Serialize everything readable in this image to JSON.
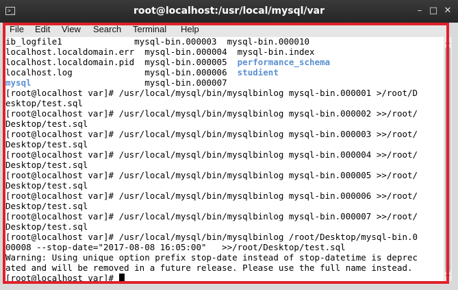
{
  "window": {
    "title": "root@localhost:/usr/local/mysql/var",
    "minimize": "–",
    "maximize": "□",
    "close": "✕",
    "icon_glyph": ">_"
  },
  "menu": [
    "File",
    "Edit",
    "View",
    "Search",
    "Terminal",
    "Help"
  ],
  "terminal": {
    "lines": [
      [
        {
          "t": "ib_logfile1              mysql-bin.000003  mysql-bin.000010"
        }
      ],
      [
        {
          "t": "localhost.localdomain.err  mysql-bin.000004  mysql-bin.index"
        }
      ],
      [
        {
          "t": "localhost.localdomain.pid  mysql-bin.000005  "
        },
        {
          "t": "performance_schema",
          "c": "blue"
        }
      ],
      [
        {
          "t": "localhost.log              mysql-bin.000006  "
        },
        {
          "t": "studient",
          "c": "blue"
        }
      ],
      [
        {
          "t": "mysql",
          "c": "blue"
        },
        {
          "t": "                      mysql-bin.000007"
        }
      ],
      [
        {
          "t": "[root@localhost var]# /usr/local/mysql/bin/mysqlbinlog mysql-bin.000001 >/root/D"
        }
      ],
      [
        {
          "t": "esktop/test.sql"
        }
      ],
      [
        {
          "t": "[root@localhost var]# /usr/local/mysql/bin/mysqlbinlog mysql-bin.000002 >>/root/"
        }
      ],
      [
        {
          "t": "Desktop/test.sql"
        }
      ],
      [
        {
          "t": "[root@localhost var]# /usr/local/mysql/bin/mysqlbinlog mysql-bin.000003 >>/root/"
        }
      ],
      [
        {
          "t": "Desktop/test.sql"
        }
      ],
      [
        {
          "t": "[root@localhost var]# /usr/local/mysql/bin/mysqlbinlog mysql-bin.000004 >>/root/"
        }
      ],
      [
        {
          "t": "Desktop/test.sql"
        }
      ],
      [
        {
          "t": "[root@localhost var]# /usr/local/mysql/bin/mysqlbinlog mysql-bin.000005 >>/root/"
        }
      ],
      [
        {
          "t": "Desktop/test.sql"
        }
      ],
      [
        {
          "t": "[root@localhost var]# /usr/local/mysql/bin/mysqlbinlog mysql-bin.000006 >>/root/"
        }
      ],
      [
        {
          "t": "Desktop/test.sql"
        }
      ],
      [
        {
          "t": "[root@localhost var]# /usr/local/mysql/bin/mysqlbinlog mysql-bin.000007 >>/root/"
        }
      ],
      [
        {
          "t": "Desktop/test.sql"
        }
      ],
      [
        {
          "t": "[root@localhost var]# /usr/local/mysql/bin/mysqlbinlog /root/Desktop/mysql-bin.0"
        }
      ],
      [
        {
          "t": "00008 --stop-date=\"2017-08-08 16:05:00\"   >>/root/Desktop/test.sql"
        }
      ],
      [
        {
          "t": "Warning: Using unique option prefix stop-date instead of stop-datetime is deprec"
        }
      ],
      [
        {
          "t": "ated and will be removed in a future release. Please use the full name instead."
        }
      ],
      [
        {
          "t": "[root@localhost var]# "
        }
      ]
    ]
  }
}
